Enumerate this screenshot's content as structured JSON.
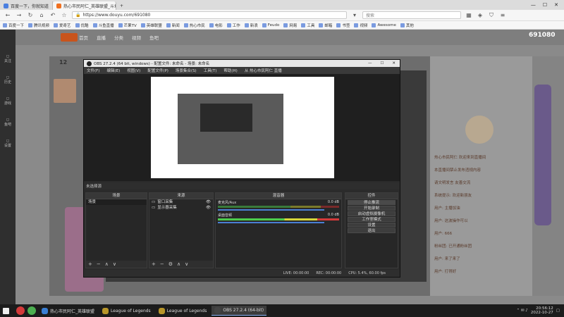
{
  "browser": {
    "tabs": [
      {
        "label": "百度一下，你就知道"
      },
      {
        "label": "热心市民阿仁_英雄联盟_斗鱼"
      }
    ],
    "url": "https://www.douyu.com/691080",
    "search_placeholder": "搜索",
    "bookmarks": [
      "百度一下",
      "腾讯视频",
      "爱奇艺",
      "优酷",
      "斗鱼直播",
      "芒果TV",
      "英雄联盟",
      "新闻",
      "热心市民",
      "电影",
      "工作",
      "新浪",
      "Feudo",
      "网易",
      "工具",
      "邮箱",
      "书签",
      "视频",
      "Awesome",
      "其他"
    ]
  },
  "site": {
    "room_id": "691080",
    "nav": [
      "首页",
      "直播",
      "分类",
      "视频",
      "鱼吧"
    ],
    "left_nav": [
      "关注",
      "历史",
      "游戏",
      "鱼吧",
      "设置"
    ],
    "viewer_count": "12"
  },
  "chat": {
    "lines": [
      "热心市民阿仁 欢迎来到直播间",
      "本直播间禁止发布违规内容",
      "请文明发言 友善交流",
      "系统提示: 欢迎新朋友",
      "用户: 主播加油",
      "用户: 这波操作可以",
      "用户: 666",
      "粉丝团: 已开通粉丝团",
      "用户: 来了来了",
      "用户: 打得好"
    ]
  },
  "obs": {
    "title": "OBS 27.2.4 (64 bit, windows) - 配置文件: 未命名 - 场景: 未命名",
    "menu": [
      "文件(F)",
      "编辑(E)",
      "视图(V)",
      "配置文件(P)",
      "场景集合(S)",
      "工具(T)",
      "帮助(H)",
      "从 热心市民阿仁 直播"
    ],
    "scene_label": "未选择源",
    "docks": {
      "scenes": "场景",
      "sources": "来源",
      "mixer": "混音器",
      "controls": "控件"
    },
    "scene_items": [
      "场景"
    ],
    "source_items": [
      "窗口采集",
      "显示器采集"
    ],
    "mixer": [
      {
        "name": "麦克风/Aux",
        "db": "0.0 dB"
      },
      {
        "name": "桌面音频",
        "db": "0.0 dB"
      }
    ],
    "controls": [
      "停止推流",
      "开始录制",
      "启动虚拟摄像机",
      "工作室模式",
      "设置",
      "退出"
    ],
    "status": {
      "live": "LIVE: 00:00:00",
      "rec": "REC: 00:00:00",
      "cpu": "CPU: 5.4%, 60.00 fps"
    }
  },
  "taskbar": {
    "apps": [
      "热心市民阿仁_英雄联盟",
      "League of Legends",
      "League of Legends",
      "OBS 27.2.4 (64-bit)"
    ],
    "time": "20:56:12",
    "date": "2022-10-27"
  },
  "colors": {
    "accent": "#4a7fd4",
    "page_bg": "#8a8a8a",
    "obs_bg": "#2b2b2b"
  }
}
